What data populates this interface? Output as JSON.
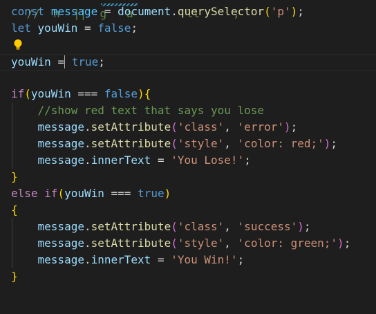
{
  "editor": {
    "theme_colors": {
      "background": "#1e1e1e",
      "keyword": "#569cd6",
      "control": "#c586c0",
      "variable": "#9cdcfe",
      "constant": "#4fc1ff",
      "function": "#dcdcaa",
      "string": "#ce9178",
      "comment": "#6a9955",
      "bracket_level1": "#ffd700",
      "bracket_level2": "#da70d6"
    },
    "icons": [
      "lightbulb-icon"
    ],
    "cutoff_line": "//  h  ||  g   a        ll     ;",
    "lines": {
      "l1": {
        "kw": "const",
        "var": "message",
        "op": "=",
        "obj": "document",
        "fn": "querySelector",
        "arg": "'p'"
      },
      "l2": {
        "kw": "let",
        "var": "youWin",
        "op": "=",
        "val": "false"
      },
      "l4": {
        "var": "youWin",
        "op": "=",
        "val": "true"
      },
      "l6": {
        "kw": "if",
        "var": "youWin",
        "op": "===",
        "val": "false"
      },
      "l7": {
        "comment": "//show red text that says you lose"
      },
      "l8": {
        "obj": "message",
        "fn": "setAttribute",
        "arg1": "'class'",
        "arg2": "'error'"
      },
      "l9": {
        "obj": "message",
        "fn": "setAttribute",
        "arg1": "'style'",
        "arg2": "'color: red;'"
      },
      "l10": {
        "obj": "message",
        "prop": "innerText",
        "op": "=",
        "val": "'You Lose!'"
      },
      "l12": {
        "kw1": "else",
        "kw2": "if",
        "var": "youWin",
        "op": "===",
        "val": "true"
      },
      "l14": {
        "obj": "message",
        "fn": "setAttribute",
        "arg1": "'class'",
        "arg2": "'success'"
      },
      "l15": {
        "obj": "message",
        "fn": "setAttribute",
        "arg1": "'style'",
        "arg2": "'color: green;'"
      },
      "l16": {
        "obj": "message",
        "prop": "innerText",
        "op": "=",
        "val": "'You Win!'"
      }
    }
  }
}
